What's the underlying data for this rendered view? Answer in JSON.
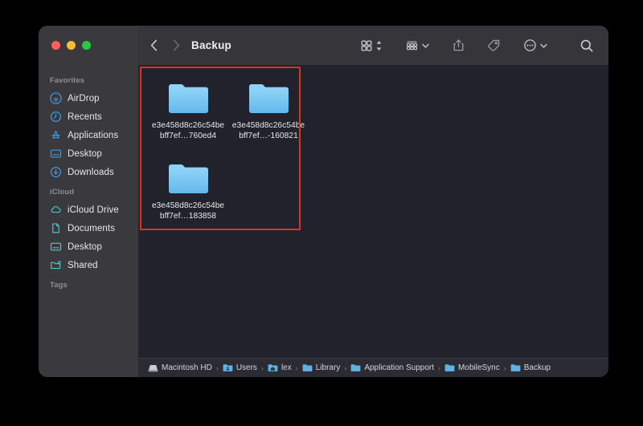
{
  "window": {
    "title": "Backup",
    "traffic_lights": [
      "close",
      "minimize",
      "zoom"
    ]
  },
  "toolbar": {
    "back_label": "‹",
    "forward_label": "›",
    "icons": [
      {
        "name": "grid-view-icon",
        "label": "Icon View"
      },
      {
        "name": "view-stepper-icon",
        "label": "View Options"
      },
      {
        "name": "group-by-icon",
        "label": "Group By"
      },
      {
        "name": "share-icon",
        "label": "Share"
      },
      {
        "name": "tag-icon",
        "label": "Tags"
      },
      {
        "name": "more-actions-icon",
        "label": "More"
      },
      {
        "name": "search-icon",
        "label": "Search"
      }
    ]
  },
  "sidebar": {
    "groups": [
      {
        "title": "Favorites",
        "items": [
          {
            "label": "AirDrop",
            "icon": "airdrop-icon"
          },
          {
            "label": "Recents",
            "icon": "recents-clock-icon"
          },
          {
            "label": "Applications",
            "icon": "applications-icon"
          },
          {
            "label": "Desktop",
            "icon": "desktop-icon"
          },
          {
            "label": "Downloads",
            "icon": "downloads-icon"
          }
        ]
      },
      {
        "title": "iCloud",
        "items": [
          {
            "label": "iCloud Drive",
            "icon": "cloud-icon"
          },
          {
            "label": "Documents",
            "icon": "document-icon"
          },
          {
            "label": "Desktop",
            "icon": "desktop-icon"
          },
          {
            "label": "Shared",
            "icon": "shared-folder-icon"
          }
        ]
      },
      {
        "title": "Tags",
        "items": []
      }
    ]
  },
  "content": {
    "files": [
      {
        "name_line1": "e3e458d8c26c54",
        "name_line2": "bebff7ef…760ed4",
        "type": "folder"
      },
      {
        "name_line1": "e3e458d8c26c54",
        "name_line2": "bebff7ef…-160821",
        "type": "folder"
      },
      {
        "name_line1": "e3e458d8c26c54",
        "name_line2": "bebff7ef…183858",
        "type": "folder"
      }
    ],
    "selection_highlight_color": "#e03020"
  },
  "path_bar": {
    "crumbs": [
      {
        "label": "Macintosh HD",
        "icon": "hard-drive-icon"
      },
      {
        "label": "Users",
        "icon": "users-folder-icon"
      },
      {
        "label": "lex",
        "icon": "home-folder-icon"
      },
      {
        "label": "Library",
        "icon": "folder-icon"
      },
      {
        "label": "Application Support",
        "icon": "folder-icon"
      },
      {
        "label": "MobileSync",
        "icon": "folder-icon"
      },
      {
        "label": "Backup",
        "icon": "folder-icon"
      }
    ],
    "separator": "›"
  },
  "colors": {
    "folder_blue": "#7fc9f2",
    "folder_blue_dark": "#5fb6e8",
    "accent_blue": "#2d9cf5",
    "teal": "#4fc4c4",
    "sidebar_bg": "#3a3a3e",
    "toolbar_bg": "#36363a",
    "content_bg": "#22222c",
    "selection_red": "#e03020"
  }
}
